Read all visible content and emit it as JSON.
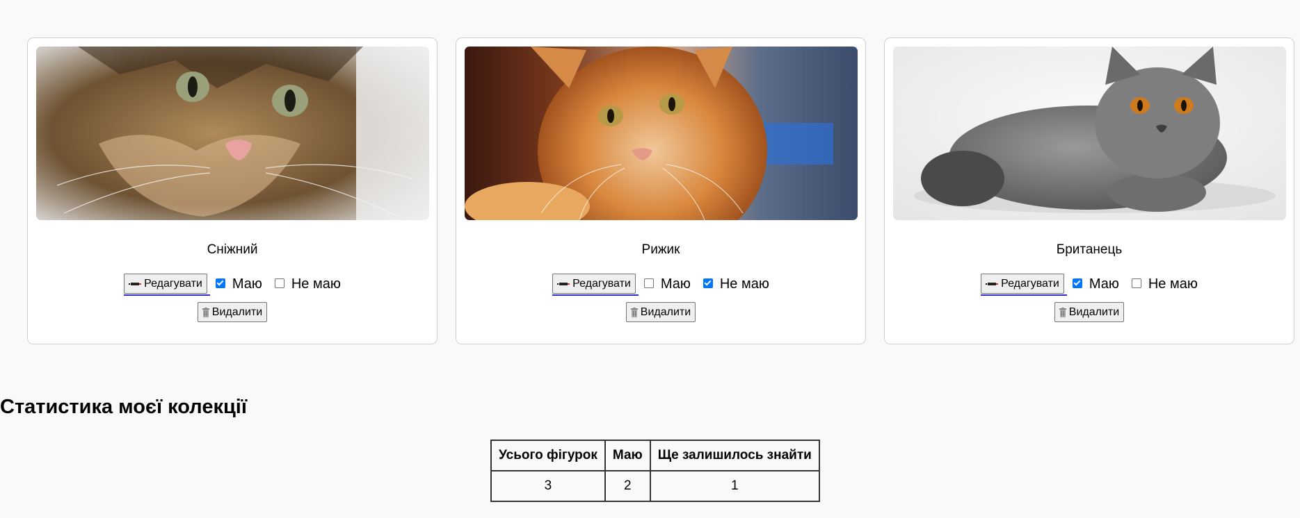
{
  "cards": [
    {
      "name": "Сніжний",
      "edit_label": "Редагувати",
      "have_label": "Маю",
      "have_checked": true,
      "not_have_label": "Не маю",
      "not_have_checked": false,
      "delete_label": "Видалити",
      "image_alt": "tabby cat close-up"
    },
    {
      "name": "Рижик",
      "edit_label": "Редагувати",
      "have_label": "Маю",
      "have_checked": false,
      "not_have_label": "Не маю",
      "not_have_checked": true,
      "delete_label": "Видалити",
      "image_alt": "ginger cat"
    },
    {
      "name": "Британець",
      "edit_label": "Редагувати",
      "have_label": "Маю",
      "have_checked": true,
      "not_have_label": "Не маю",
      "not_have_checked": false,
      "delete_label": "Видалити",
      "image_alt": "british shorthair grey cat"
    }
  ],
  "stats": {
    "title": "Статистика моєї колекції",
    "headers": [
      "Усього фігурок",
      "Маю",
      "Ще залишилось знайти"
    ],
    "values": [
      "3",
      "2",
      "1"
    ]
  },
  "colors": {
    "checkbox_checked": "#0075ff",
    "edit_underline": "#2a2ad6"
  },
  "icons": {
    "edit": "pen-icon",
    "delete": "trash-icon"
  }
}
